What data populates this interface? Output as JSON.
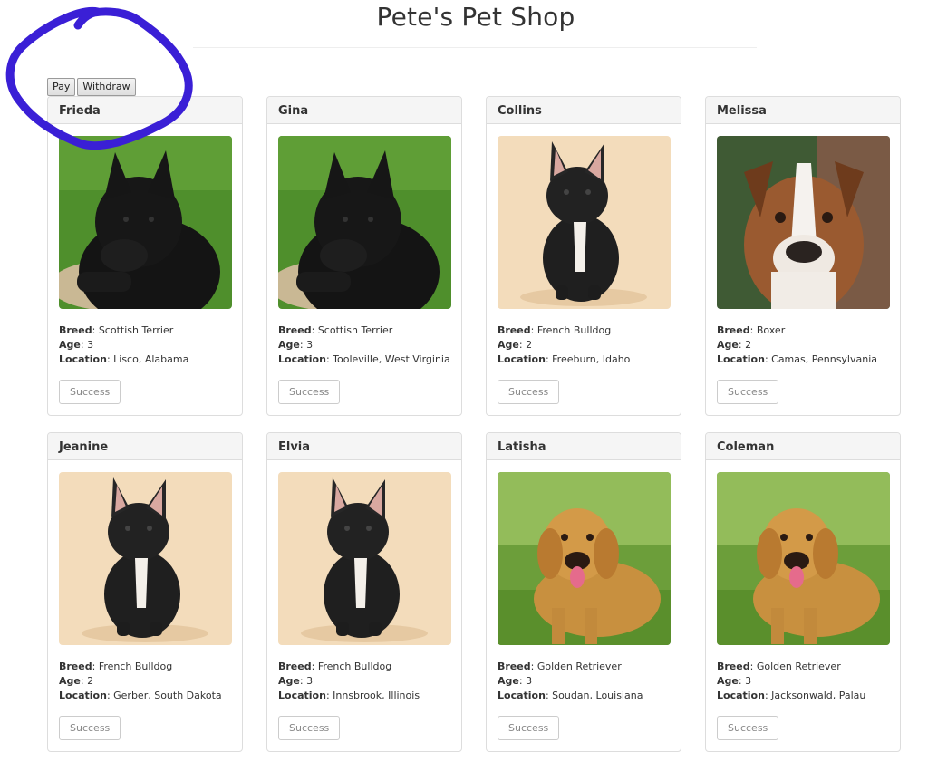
{
  "header": {
    "title": "Pete's Pet Shop"
  },
  "actions": {
    "pay_label": "Pay",
    "withdraw_label": "Withdraw"
  },
  "labels": {
    "breed": "Breed",
    "age": "Age",
    "location": "Location"
  },
  "pets": [
    {
      "name": "Frieda",
      "breed": "Scottish Terrier",
      "age": "3",
      "location": "Lisco, Alabama",
      "button": "Success",
      "photo": "scottish-terrier-icon"
    },
    {
      "name": "Gina",
      "breed": "Scottish Terrier",
      "age": "3",
      "location": "Tooleville, West Virginia",
      "button": "Success",
      "photo": "scottish-terrier-icon"
    },
    {
      "name": "Collins",
      "breed": "French Bulldog",
      "age": "2",
      "location": "Freeburn, Idaho",
      "button": "Success",
      "photo": "french-bulldog-icon"
    },
    {
      "name": "Melissa",
      "breed": "Boxer",
      "age": "2",
      "location": "Camas, Pennsylvania",
      "button": "Success",
      "photo": "boxer-icon"
    },
    {
      "name": "Jeanine",
      "breed": "French Bulldog",
      "age": "2",
      "location": "Gerber, South Dakota",
      "button": "Success",
      "photo": "french-bulldog-icon"
    },
    {
      "name": "Elvia",
      "breed": "French Bulldog",
      "age": "3",
      "location": "Innsbrook, Illinois",
      "button": "Success",
      "photo": "french-bulldog-icon"
    },
    {
      "name": "Latisha",
      "breed": "Golden Retriever",
      "age": "3",
      "location": "Soudan, Louisiana",
      "button": "Success",
      "photo": "golden-retriever-icon"
    },
    {
      "name": "Coleman",
      "breed": "Golden Retriever",
      "age": "3",
      "location": "Jacksonwald, Palau",
      "button": "Success",
      "photo": "golden-retriever-icon"
    }
  ],
  "colors": {
    "scribble": "#3a1fd6",
    "card_header_bg": "#f5f5f5",
    "border": "#dddddd"
  }
}
